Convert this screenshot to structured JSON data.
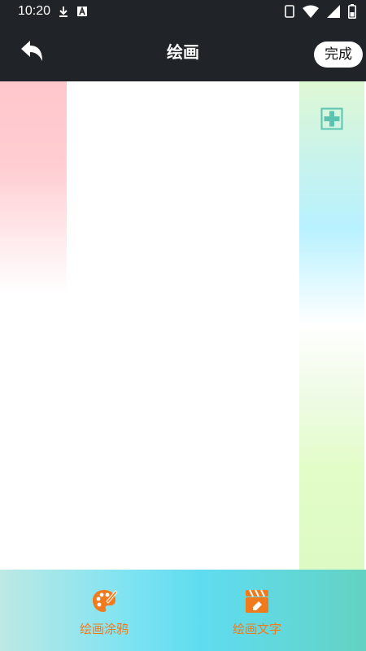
{
  "status_bar": {
    "time": "10:20",
    "icons": [
      "download-icon",
      "a-notification-icon",
      "sim-card-icon",
      "wifi-icon",
      "signal-icon",
      "battery-icon"
    ]
  },
  "app_bar": {
    "title": "绘画",
    "done_label": "完成",
    "back_icon": "back-arrow-icon"
  },
  "palette": {
    "add_icon": "plus-square-icon"
  },
  "bottom_nav": {
    "items": [
      {
        "label": "绘画涂鸦",
        "icon": "palette-icon"
      },
      {
        "label": "绘画文字",
        "icon": "clapperboard-text-icon"
      }
    ],
    "accent": "#f07a1e"
  },
  "colors": {
    "header_bg": "#202428",
    "accent": "#f07a1e",
    "plus": "#5cc3b0"
  }
}
